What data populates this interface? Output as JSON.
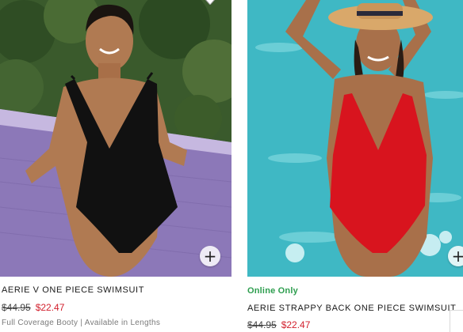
{
  "products": [
    {
      "name": "AERIE V ONE PIECE SWIMSUIT",
      "price_original": "$44.95",
      "price_sale": "$22.47",
      "features": "Full Coverage Booty | Available in Lengths",
      "photo_icon": "product-photo-black-swimsuit",
      "add_icon": "plus"
    },
    {
      "badge": "Online Only",
      "name": "AERIE STRAPPY BACK ONE PIECE SWIMSUIT",
      "price_original": "$44.95",
      "price_sale": "$22.47",
      "photo_icon": "product-photo-red-swimsuit",
      "add_icon": "plus"
    }
  ],
  "colors": {
    "sale_price": "#d2202d",
    "online_badge": "#2e9e4f",
    "swimsuit_1": "#111111",
    "swimsuit_2": "#d8141e"
  },
  "icons": {
    "add": "+"
  }
}
